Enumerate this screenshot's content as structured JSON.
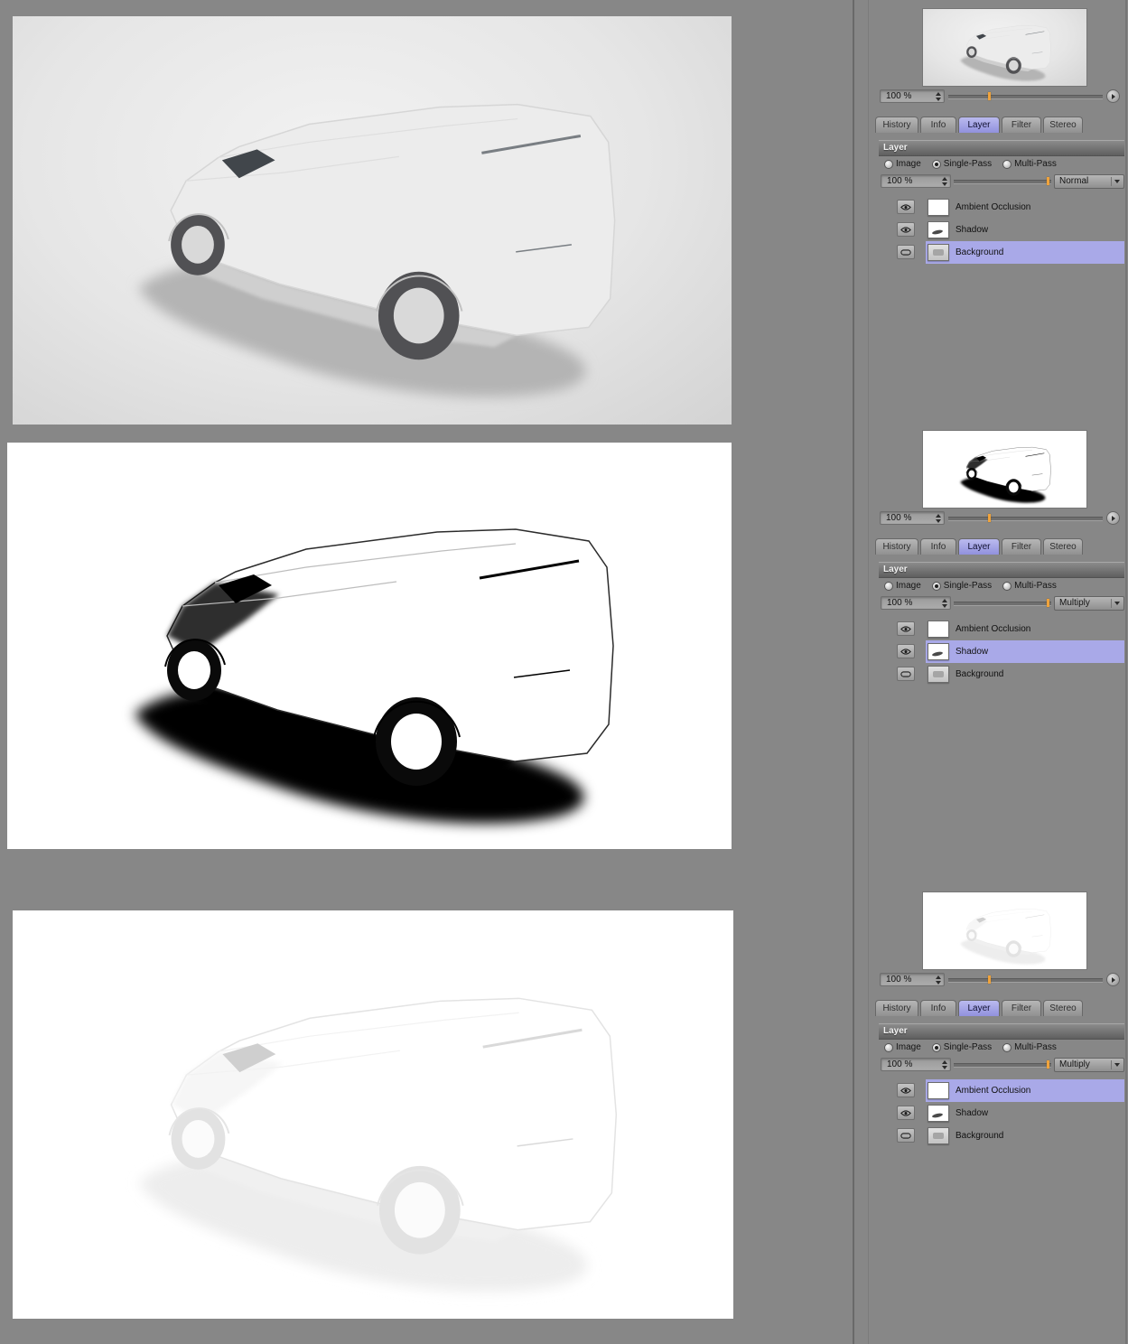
{
  "colors": {
    "page_background": "#878787",
    "active_tab": "#9d9de0",
    "selected_row": "#a9a9e8",
    "slider_tick": "#f0a33c"
  },
  "viewports": [
    {
      "name": "composite-render"
    },
    {
      "name": "shadow-pass-render"
    },
    {
      "name": "ambient-occlusion-render"
    }
  ],
  "panels": [
    {
      "zoom_value": "100 %",
      "tabs": [
        "History",
        "Info",
        "Layer",
        "Filter",
        "Stereo"
      ],
      "active_tab": "Layer",
      "layer_panel": {
        "title": "Layer",
        "modes": [
          "Image",
          "Single-Pass",
          "Multi-Pass"
        ],
        "selected_mode": "Single-Pass",
        "opacity_value": "100 %",
        "blend_mode": "Normal",
        "layers": [
          {
            "name": "Ambient Occlusion",
            "selected": false,
            "icon": "eye-icon"
          },
          {
            "name": "Shadow",
            "selected": false,
            "icon": "eye-icon"
          },
          {
            "name": "Background",
            "selected": true,
            "icon": "frame-icon"
          }
        ],
        "selected_layer": "Background"
      }
    },
    {
      "zoom_value": "100 %",
      "tabs": [
        "History",
        "Info",
        "Layer",
        "Filter",
        "Stereo"
      ],
      "active_tab": "Layer",
      "layer_panel": {
        "title": "Layer",
        "modes": [
          "Image",
          "Single-Pass",
          "Multi-Pass"
        ],
        "selected_mode": "Single-Pass",
        "opacity_value": "100 %",
        "blend_mode": "Multiply",
        "layers": [
          {
            "name": "Ambient Occlusion",
            "selected": false,
            "icon": "eye-icon"
          },
          {
            "name": "Shadow",
            "selected": true,
            "icon": "eye-icon"
          },
          {
            "name": "Background",
            "selected": false,
            "icon": "frame-icon"
          }
        ],
        "selected_layer": "Shadow"
      }
    },
    {
      "zoom_value": "100 %",
      "tabs": [
        "History",
        "Info",
        "Layer",
        "Filter",
        "Stereo"
      ],
      "active_tab": "Layer",
      "layer_panel": {
        "title": "Layer",
        "modes": [
          "Image",
          "Single-Pass",
          "Multi-Pass"
        ],
        "selected_mode": "Single-Pass",
        "opacity_value": "100 %",
        "blend_mode": "Multiply",
        "layers": [
          {
            "name": "Ambient Occlusion",
            "selected": true,
            "icon": "eye-icon"
          },
          {
            "name": "Shadow",
            "selected": false,
            "icon": "eye-icon"
          },
          {
            "name": "Background",
            "selected": false,
            "icon": "frame-icon"
          }
        ],
        "selected_layer": "Ambient Occlusion"
      }
    }
  ]
}
